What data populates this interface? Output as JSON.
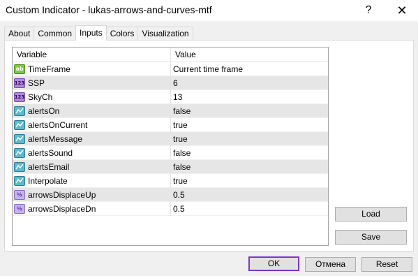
{
  "window": {
    "title": "Custom Indicator - lukas-arrows-and-curves-mtf",
    "help_label": "?",
    "close_label": "✕"
  },
  "tabs": [
    {
      "label": "About"
    },
    {
      "label": "Common"
    },
    {
      "label": "Inputs",
      "active": true
    },
    {
      "label": "Colors"
    },
    {
      "label": "Visualization"
    }
  ],
  "grid": {
    "headers": {
      "variable": "Variable",
      "value": "Value"
    },
    "rows": [
      {
        "icon": "string-type-icon",
        "badge": "ab",
        "variable": "TimeFrame",
        "value": "Current time frame"
      },
      {
        "icon": "integer-type-icon",
        "badge": "123",
        "variable": "SSP",
        "value": "6"
      },
      {
        "icon": "integer-type-icon",
        "badge": "123",
        "variable": "SkyCh",
        "value": "13"
      },
      {
        "icon": "boolean-type-icon",
        "badge": "",
        "variable": "alertsOn",
        "value": "false"
      },
      {
        "icon": "boolean-type-icon",
        "badge": "",
        "variable": "alertsOnCurrent",
        "value": "true"
      },
      {
        "icon": "boolean-type-icon",
        "badge": "",
        "variable": "alertsMessage",
        "value": "true"
      },
      {
        "icon": "boolean-type-icon",
        "badge": "",
        "variable": "alertsSound",
        "value": "false"
      },
      {
        "icon": "boolean-type-icon",
        "badge": "",
        "variable": "alertsEmail",
        "value": "false"
      },
      {
        "icon": "boolean-type-icon",
        "badge": "",
        "variable": "Interpolate",
        "value": "true"
      },
      {
        "icon": "double-type-icon",
        "badge": "½",
        "variable": "arrowsDisplaceUp",
        "value": "0.5"
      },
      {
        "icon": "double-type-icon",
        "badge": "½",
        "variable": "arrowsDisplaceDn",
        "value": "0.5"
      }
    ]
  },
  "buttons": {
    "load": "Load",
    "save": "Save",
    "ok": "OK",
    "cancel": "Отмена",
    "reset": "Reset"
  }
}
